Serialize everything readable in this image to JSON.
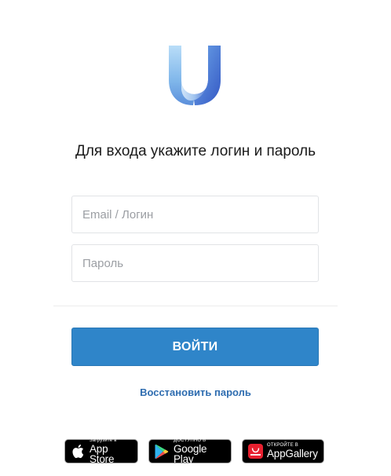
{
  "heading": "Для входа укажите логин и пароль",
  "form": {
    "login_placeholder": "Email / Логин",
    "password_placeholder": "Пароль",
    "submit_label": "ВОЙТИ",
    "restore_label": "Восстановить пароль"
  },
  "stores": [
    {
      "small": "Загрузите в",
      "big": "App Store",
      "icon": "apple-icon"
    },
    {
      "small": "ДОСТУПНО В",
      "big": "Google Play",
      "icon": "google-play-icon"
    },
    {
      "small": "ОТКРОЙТЕ В",
      "big": "AppGallery",
      "icon": "huawei-appgallery-icon"
    }
  ],
  "colors": {
    "primary_button": "#2f85c9",
    "link": "#2f6db0",
    "logo_light": "#a9d3f5",
    "logo_dark": "#3a68c9"
  }
}
